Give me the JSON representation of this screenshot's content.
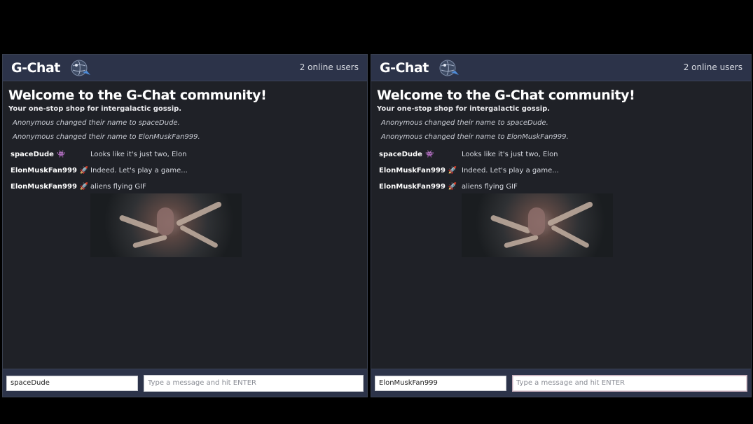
{
  "panels": [
    {
      "header": {
        "brand": "G-Chat",
        "online": "2 online users"
      },
      "welcome": "Welcome to the G-Chat community!",
      "tagline": "Your one-stop shop for intergalactic gossip.",
      "system_messages": [
        "Anonymous changed their name to spaceDude.",
        "Anonymous changed their name to ElonMuskFan999."
      ],
      "messages": [
        {
          "sender": "spaceDude",
          "icon": "alien-icon",
          "text": "Looks like it's just two, Elon"
        },
        {
          "sender": "ElonMuskFan999",
          "icon": "rocket-icon",
          "text": "Indeed. Let's play a game..."
        },
        {
          "sender": "ElonMuskFan999",
          "icon": "rocket-icon",
          "text": "aliens flying GIF"
        }
      ],
      "footer": {
        "name_value": "spaceDude",
        "message_placeholder": "Type a message and hit ENTER"
      }
    },
    {
      "header": {
        "brand": "G-Chat",
        "online": "2 online users"
      },
      "welcome": "Welcome to the G-Chat community!",
      "tagline": "Your one-stop shop for intergalactic gossip.",
      "system_messages": [
        "Anonymous changed their name to spaceDude.",
        "Anonymous changed their name to ElonMuskFan999."
      ],
      "messages": [
        {
          "sender": "spaceDude",
          "icon": "alien-icon",
          "text": "Looks like it's just two, Elon"
        },
        {
          "sender": "ElonMuskFan999",
          "icon": "rocket-icon",
          "text": "Indeed. Let's play a game..."
        },
        {
          "sender": "ElonMuskFan999",
          "icon": "rocket-icon",
          "text": "aliens flying GIF"
        }
      ],
      "footer": {
        "name_value": "ElonMuskFan999",
        "message_placeholder": "Type a message and hit ENTER"
      }
    }
  ],
  "colors": {
    "background": "#000000",
    "panel": "#1f2127",
    "header": "#2c3349",
    "alien": "#b14ee0",
    "rocket": "#d98f7a"
  }
}
